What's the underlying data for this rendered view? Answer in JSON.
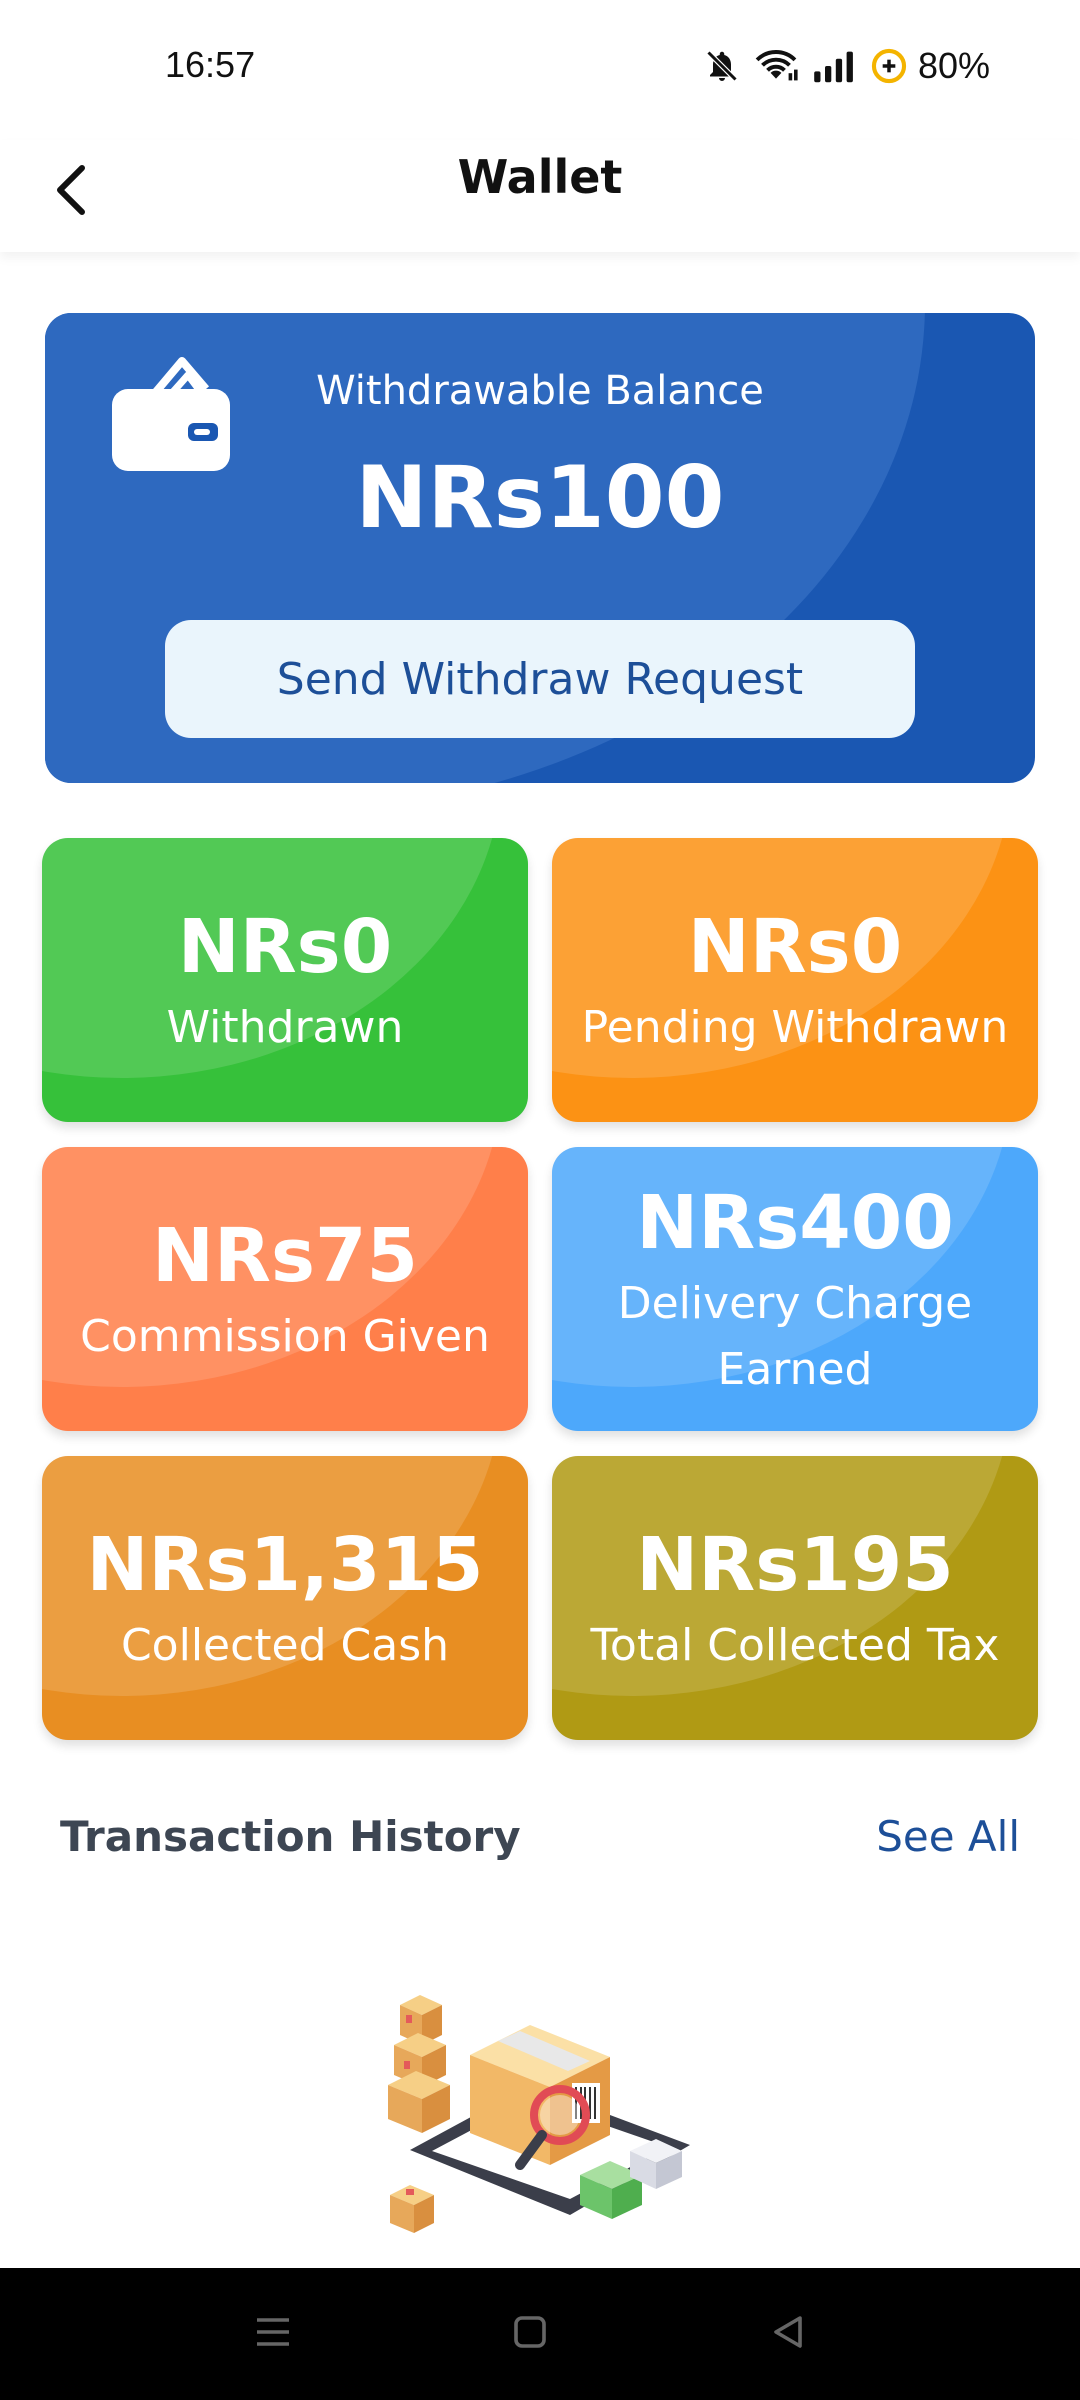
{
  "status_bar": {
    "time": "16:57",
    "battery": "80%",
    "icons": [
      "bell-off-icon",
      "wifi-icon",
      "signal-icon",
      "battery-saver-icon"
    ]
  },
  "app_bar": {
    "title": "Wallet",
    "back_icon": "back-arrow-icon"
  },
  "balance_card": {
    "label": "Withdrawable Balance",
    "amount": "NRs100",
    "button_label": "Send Withdraw Request",
    "icon": "wallet-icon",
    "color": "#1a57b2"
  },
  "stats": [
    {
      "value": "NRs0",
      "label": "Withdrawn",
      "color": "#36c13a"
    },
    {
      "value": "NRs0",
      "label": "Pending Withdrawn",
      "color": "#fc9214"
    },
    {
      "value": "NRs75",
      "label": "Commission Given",
      "color": "#ff7f4a"
    },
    {
      "value": "NRs400",
      "label": "Delivery Charge Earned",
      "color": "#4da8fb"
    },
    {
      "value": "NRs1,315",
      "label": "Collected Cash",
      "color": "#e88e22"
    },
    {
      "value": "NRs195",
      "label": "Total Collected Tax",
      "color": "#b09a14"
    }
  ],
  "transaction_history": {
    "title": "Transaction History",
    "see_all": "See All",
    "empty_icon": "empty-packages-illustration"
  },
  "nav_bar": {
    "icons": [
      "menu-icon",
      "home-icon",
      "back-icon"
    ]
  }
}
